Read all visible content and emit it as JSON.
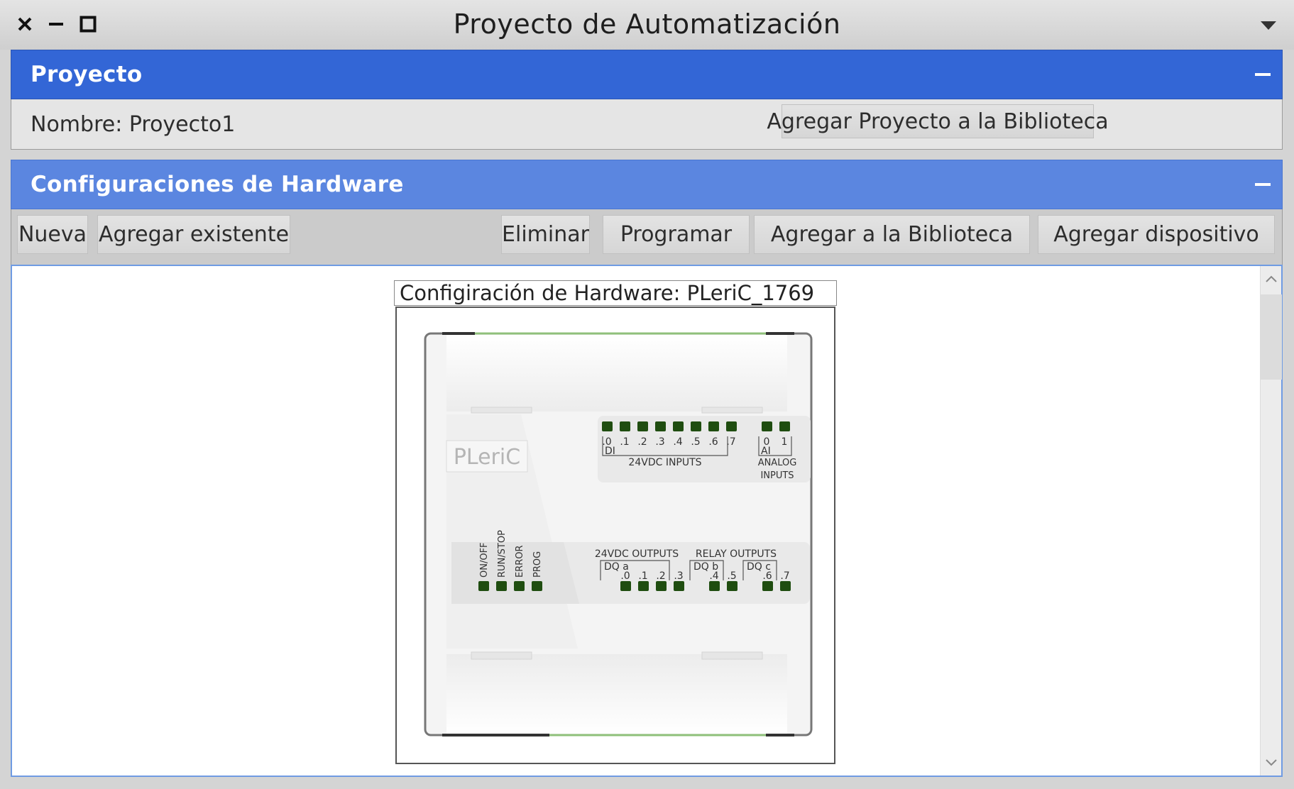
{
  "window": {
    "title": "Proyecto de Automatización",
    "close_icon": "close-icon",
    "minimize_icon": "minimize-icon",
    "maximize_icon": "maximize-icon",
    "menu_icon": "chevron-down-icon"
  },
  "project_panel": {
    "header": "Proyecto",
    "name_label": "Nombre: Proyecto1",
    "add_to_library_button": "Agregar Proyecto a la Biblioteca"
  },
  "hardware_panel": {
    "header": "Configuraciones de Hardware",
    "toolbar": {
      "new": "Nueva",
      "add_existing": "Agregar existente",
      "delete": "Eliminar",
      "program": "Programar",
      "add_to_library": "Agregar a la Biblioteca",
      "add_device": "Agregar dispositivo"
    },
    "config_title": "Configiración de Hardware: PLeriC_1769"
  },
  "plc": {
    "brand": "PLeriC",
    "digital_inputs": {
      "prefix": "DI",
      "labels": [
        ".0",
        ".1",
        ".2",
        ".3",
        ".4",
        ".5",
        ".6",
        ".7"
      ],
      "caption": "24VDC INPUTS"
    },
    "analog_inputs": {
      "prefix": "AI",
      "labels": [
        "0",
        "1"
      ],
      "caption_line1": "ANALOG",
      "caption_line2": "INPUTS"
    },
    "status_leds": [
      "ON/OFF",
      "RUN/STOP",
      "ERROR",
      "PROG"
    ],
    "dc_outputs": {
      "caption": "24VDC OUTPUTS",
      "group": "DQ a",
      "labels": [
        ".0",
        ".1",
        ".2",
        ".3"
      ]
    },
    "relay_outputs": {
      "caption": "RELAY OUTPUTS",
      "group_b": "DQ b",
      "labels_b": [
        ".4",
        ".5"
      ],
      "group_c": "DQ c",
      "labels_c": [
        ".6",
        ".7"
      ]
    },
    "colors": {
      "led": "#1f4d10",
      "accent_green": "#8fc07a"
    }
  }
}
